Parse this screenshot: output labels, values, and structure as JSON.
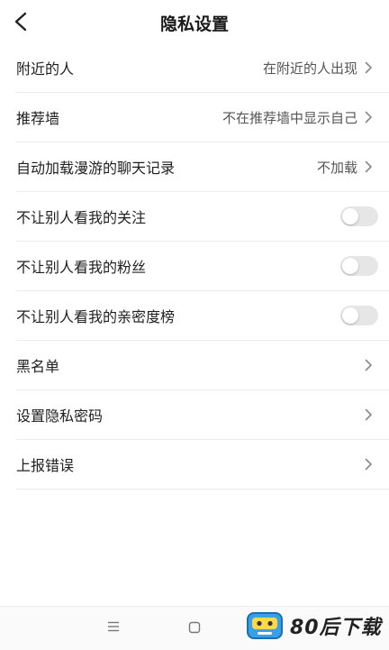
{
  "header": {
    "title": "隐私设置"
  },
  "rows": [
    {
      "label": "附近的人",
      "value": "在附近的人出现"
    },
    {
      "label": "推荐墙",
      "value": "不在推荐墙中显示自己"
    },
    {
      "label": "自动加载漫游的聊天记录",
      "value": "不加载"
    },
    {
      "label": "不让别人看我的关注",
      "toggle_on": false
    },
    {
      "label": "不让别人看我的粉丝",
      "toggle_on": false
    },
    {
      "label": "不让别人看我的亲密度榜",
      "toggle_on": false
    },
    {
      "label": "黑名单"
    },
    {
      "label": "设置隐私密码"
    },
    {
      "label": "上报错误"
    }
  ],
  "navbar": {
    "icons": [
      "menu-icon",
      "square-home-icon"
    ]
  },
  "watermark": {
    "text": "80后下载"
  }
}
